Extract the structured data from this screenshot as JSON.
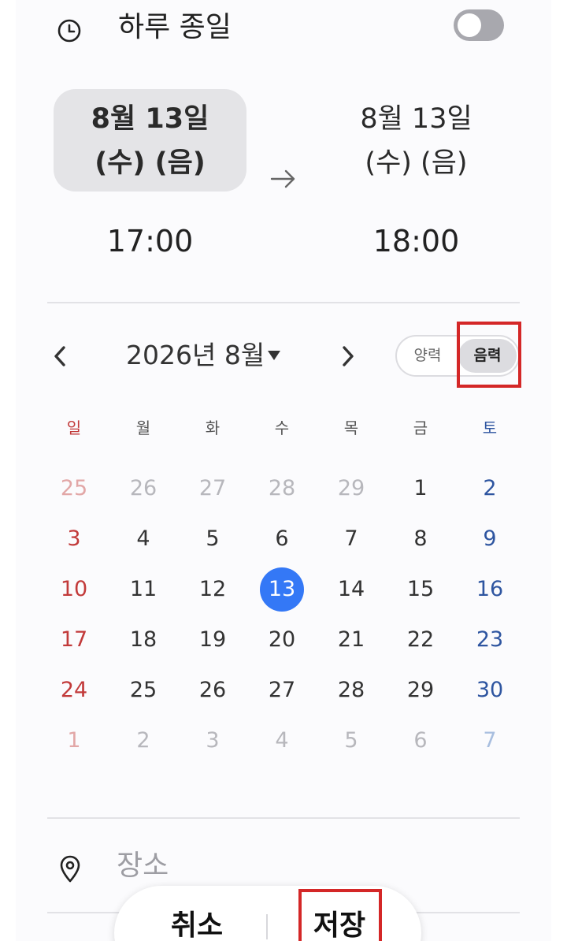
{
  "all_day": {
    "label": "하루 종일",
    "enabled": false,
    "icon": "clock-icon"
  },
  "start": {
    "date_line1": "8월 13일",
    "date_line2": "(수) (음)",
    "time": "17:00"
  },
  "end": {
    "date_line1": "8월 13일",
    "date_line2": "(수) (음)",
    "time": "18:00"
  },
  "calendar": {
    "month_label": "2026년 8월",
    "calendar_type": {
      "solar_label": "양력",
      "lunar_label": "음력",
      "selected": "lunar"
    },
    "weekdays": [
      "일",
      "월",
      "화",
      "수",
      "목",
      "금",
      "토"
    ],
    "weeks": [
      [
        {
          "d": "25",
          "m": true
        },
        {
          "d": "26",
          "m": true
        },
        {
          "d": "27",
          "m": true
        },
        {
          "d": "28",
          "m": true
        },
        {
          "d": "29",
          "m": true
        },
        {
          "d": "1"
        },
        {
          "d": "2"
        }
      ],
      [
        {
          "d": "3"
        },
        {
          "d": "4"
        },
        {
          "d": "5"
        },
        {
          "d": "6"
        },
        {
          "d": "7"
        },
        {
          "d": "8"
        },
        {
          "d": "9"
        }
      ],
      [
        {
          "d": "10"
        },
        {
          "d": "11"
        },
        {
          "d": "12"
        },
        {
          "d": "13",
          "selected": true
        },
        {
          "d": "14"
        },
        {
          "d": "15"
        },
        {
          "d": "16"
        }
      ],
      [
        {
          "d": "17"
        },
        {
          "d": "18"
        },
        {
          "d": "19"
        },
        {
          "d": "20"
        },
        {
          "d": "21"
        },
        {
          "d": "22"
        },
        {
          "d": "23"
        }
      ],
      [
        {
          "d": "24"
        },
        {
          "d": "25"
        },
        {
          "d": "26"
        },
        {
          "d": "27"
        },
        {
          "d": "28"
        },
        {
          "d": "29"
        },
        {
          "d": "30"
        }
      ],
      [
        {
          "d": "1",
          "m": true
        },
        {
          "d": "2",
          "m": true
        },
        {
          "d": "3",
          "m": true
        },
        {
          "d": "4",
          "m": true
        },
        {
          "d": "5",
          "m": true
        },
        {
          "d": "6",
          "m": true
        },
        {
          "d": "7",
          "m": true
        }
      ]
    ]
  },
  "location": {
    "placeholder": "장소",
    "icon": "location-pin-icon"
  },
  "actions": {
    "cancel_label": "취소",
    "save_label": "저장"
  },
  "colors": {
    "selected_day": "#3478f6",
    "sunday": "#c23a3a",
    "saturday": "#2e55a0",
    "highlight": "#d42727"
  }
}
